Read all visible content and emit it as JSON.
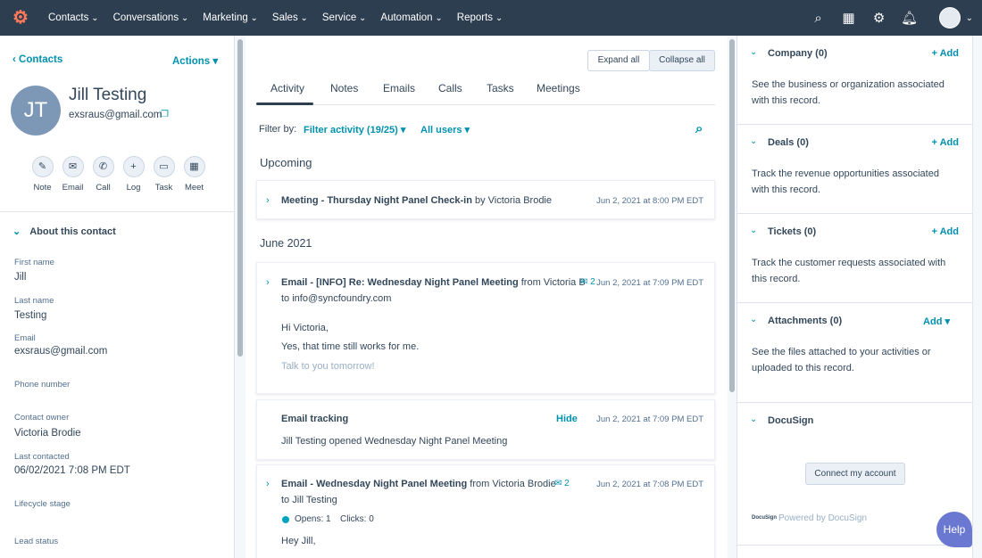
{
  "nav": {
    "items": [
      "Contacts",
      "Conversations",
      "Marketing",
      "Sales",
      "Service",
      "Automation",
      "Reports"
    ]
  },
  "left": {
    "back": "Contacts",
    "actions": "Actions",
    "initials": "JT",
    "name": "Jill Testing",
    "email": "exsraus@gmail.com",
    "quick_actions": [
      "Note",
      "Email",
      "Call",
      "Log",
      "Task",
      "Meet"
    ],
    "about": "About this contact",
    "props": [
      {
        "label": "First name",
        "value": "Jill"
      },
      {
        "label": "Last name",
        "value": "Testing"
      },
      {
        "label": "Email",
        "value": "exsraus@gmail.com"
      },
      {
        "label": "Phone number",
        "value": ""
      },
      {
        "label": "Contact owner",
        "value": "Victoria Brodie"
      },
      {
        "label": "Last contacted",
        "value": "06/02/2021 7:08 PM EDT"
      },
      {
        "label": "Lifecycle stage",
        "value": ""
      },
      {
        "label": "Lead status",
        "value": ""
      }
    ]
  },
  "mid": {
    "expand": "Expand all",
    "collapse": "Collapse all",
    "tabs": [
      "Activity",
      "Notes",
      "Emails",
      "Calls",
      "Tasks",
      "Meetings"
    ],
    "filter_by": "Filter by:",
    "filter_activity": "Filter activity (19/25)",
    "all_users": "All users",
    "upcoming": "Upcoming",
    "june": "June 2021",
    "meeting": {
      "title": "Meeting - Thursday Night Panel Check-in",
      "by": "by Victoria Brodie",
      "date": "Jun 2, 2021 at 8:00 PM EDT"
    },
    "email1": {
      "title": "Email - [INFO] Re: Wednesday Night Panel Meeting",
      "from": "from Victoria B",
      "count": "2",
      "date": "Jun 2, 2021 at 7:09 PM EDT",
      "to": "to info@syncfoundry.com",
      "lines": [
        "Hi Victoria,",
        "Yes, that time still works for me.",
        "Talk to you tomorrow!"
      ]
    },
    "tracking": {
      "title": "Email tracking",
      "hide": "Hide",
      "date": "Jun 2, 2021 at 7:09 PM EDT",
      "text": "Jill Testing opened Wednesday Night Panel Meeting"
    },
    "email2": {
      "title": "Email - Wednesday Night Panel Meeting",
      "from": "from Victoria Brodie",
      "count": "2",
      "date": "Jun 2, 2021 at 7:08 PM EDT",
      "to": "to Jill Testing",
      "opens": "Opens: 1",
      "clicks": "Clicks: 0",
      "greeting": "Hey Jill,"
    }
  },
  "right": {
    "sections": [
      {
        "title": "Company (0)",
        "add": "+ Add",
        "desc": "See the business or organization associated with this record."
      },
      {
        "title": "Deals (0)",
        "add": "+ Add",
        "desc": "Track the revenue opportunities associated with this record."
      },
      {
        "title": "Tickets (0)",
        "add": "+ Add",
        "desc": "Track the customer requests associated with this record."
      },
      {
        "title": "Attachments (0)",
        "add": "Add ▾",
        "desc": "See the files attached to your activities or uploaded to this record."
      }
    ],
    "docusign": {
      "title": "DocuSign",
      "connect": "Connect my account",
      "powered": "Powered by DocuSign",
      "logo": "DocuSign"
    }
  },
  "help": "Help",
  "colors": {
    "nav": "#2d3e50",
    "accent": "#0091ae",
    "help": "#6a78d1"
  }
}
